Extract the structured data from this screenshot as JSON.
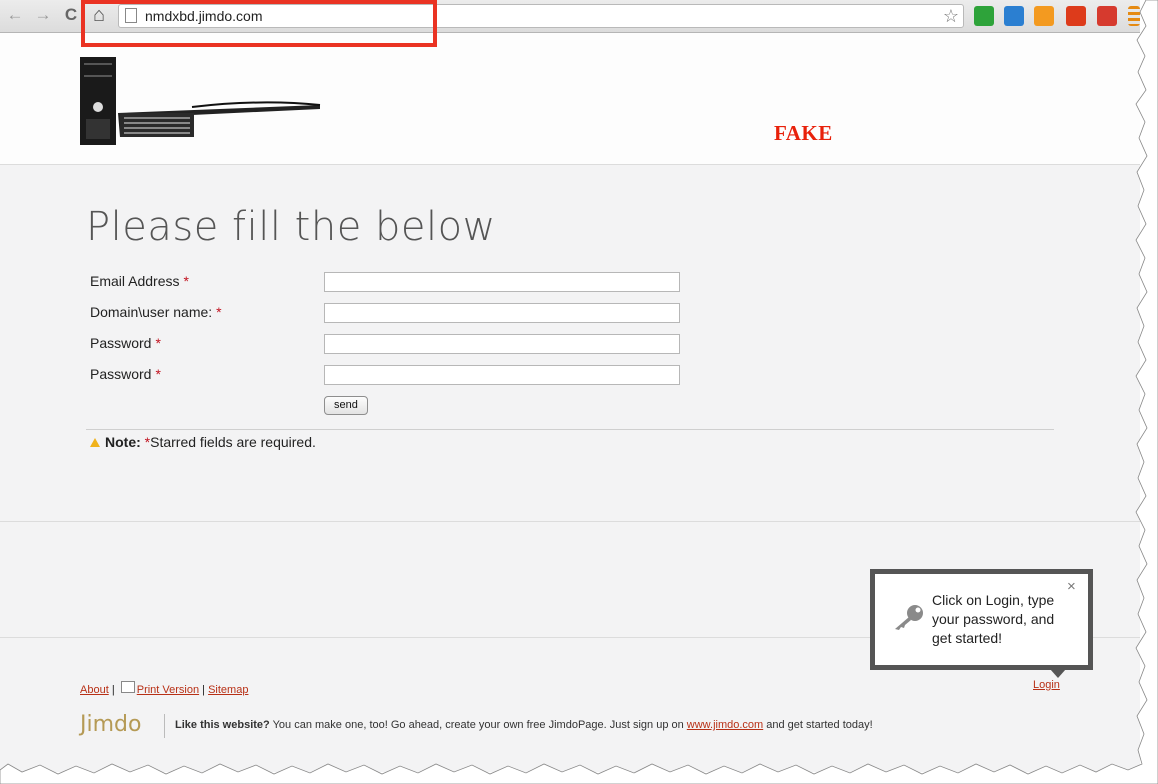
{
  "browser": {
    "url": "nmdxbd.jimdo.com",
    "back_glyph": "←",
    "forward_glyph": "→",
    "reload_glyph": "C",
    "home_glyph": "⌂",
    "star_glyph": "☆",
    "extensions": [
      "robot-extension-icon",
      "send-extension-icon",
      "rss-extension-icon",
      "tt-extension-icon",
      "bookmark-extension-icon",
      "menu-icon"
    ]
  },
  "header": {
    "badge_text": "FAKE",
    "badge_color": "#e8210b"
  },
  "form": {
    "title": "Please fill the below",
    "fields": [
      {
        "label": "Email Address",
        "required": "*",
        "value": ""
      },
      {
        "label": "Domain\\user name:",
        "required": "*",
        "value": ""
      },
      {
        "label": "Password",
        "required": "*",
        "value": ""
      },
      {
        "label": "Password",
        "required": "*",
        "value": ""
      }
    ],
    "submit_label": "send",
    "note_label": "Note:",
    "note_star": "*",
    "note_text": "Starred fields are required."
  },
  "footer": {
    "about": "About",
    "sep1": "|",
    "print_version": "Print Version",
    "sep2": "|",
    "sitemap": "Sitemap",
    "brand": "Jimdo",
    "promo_bold": "Like this website?",
    "promo_text": " You can make one, too! Go ahead, create your own free JimdoPage. Just sign up on ",
    "promo_link": "www.jimdo.com",
    "promo_tail": " and get started today!",
    "login": "Login"
  },
  "tooltip": {
    "text": "Click on Login, type your password, and get started!",
    "close_glyph": "×"
  },
  "colors": {
    "highlight_box": "#ea3323",
    "link": "#b83016",
    "required": "#c1121f"
  }
}
